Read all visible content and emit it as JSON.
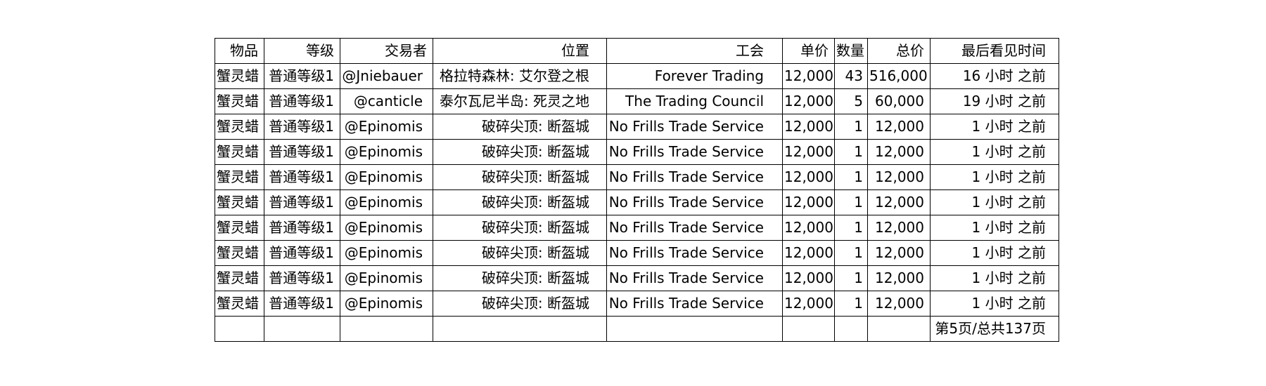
{
  "table": {
    "headers": [
      "物品",
      "等级",
      "交易者",
      "位置",
      "工会",
      "单价",
      "数量",
      "总价",
      "最后看见时间"
    ],
    "rows": [
      [
        "蟹灵蜡",
        "普通等级1",
        "@Jniebauer",
        "格拉特森林: 艾尔登之根",
        "Forever Trading",
        "12,000",
        "43",
        "516,000",
        "16 小时 之前"
      ],
      [
        "蟹灵蜡",
        "普通等级1",
        "@canticle",
        "泰尔瓦尼半岛: 死灵之地",
        "The Trading Council",
        "12,000",
        "5",
        "60,000",
        "19 小时 之前"
      ],
      [
        "蟹灵蜡",
        "普通等级1",
        "@Epinomis",
        "破碎尖顶: 断盔城",
        "No Frills Trade Service",
        "12,000",
        "1",
        "12,000",
        "1 小时 之前"
      ],
      [
        "蟹灵蜡",
        "普通等级1",
        "@Epinomis",
        "破碎尖顶: 断盔城",
        "No Frills Trade Service",
        "12,000",
        "1",
        "12,000",
        "1 小时 之前"
      ],
      [
        "蟹灵蜡",
        "普通等级1",
        "@Epinomis",
        "破碎尖顶: 断盔城",
        "No Frills Trade Service",
        "12,000",
        "1",
        "12,000",
        "1 小时 之前"
      ],
      [
        "蟹灵蜡",
        "普通等级1",
        "@Epinomis",
        "破碎尖顶: 断盔城",
        "No Frills Trade Service",
        "12,000",
        "1",
        "12,000",
        "1 小时 之前"
      ],
      [
        "蟹灵蜡",
        "普通等级1",
        "@Epinomis",
        "破碎尖顶: 断盔城",
        "No Frills Trade Service",
        "12,000",
        "1",
        "12,000",
        "1 小时 之前"
      ],
      [
        "蟹灵蜡",
        "普通等级1",
        "@Epinomis",
        "破碎尖顶: 断盔城",
        "No Frills Trade Service",
        "12,000",
        "1",
        "12,000",
        "1 小时 之前"
      ],
      [
        "蟹灵蜡",
        "普通等级1",
        "@Epinomis",
        "破碎尖顶: 断盔城",
        "No Frills Trade Service",
        "12,000",
        "1",
        "12,000",
        "1 小时 之前"
      ],
      [
        "蟹灵蜡",
        "普通等级1",
        "@Epinomis",
        "破碎尖顶: 断盔城",
        "No Frills Trade Service",
        "12,000",
        "1",
        "12,000",
        "1 小时 之前"
      ]
    ],
    "pagination": "第5页/总共137页"
  }
}
